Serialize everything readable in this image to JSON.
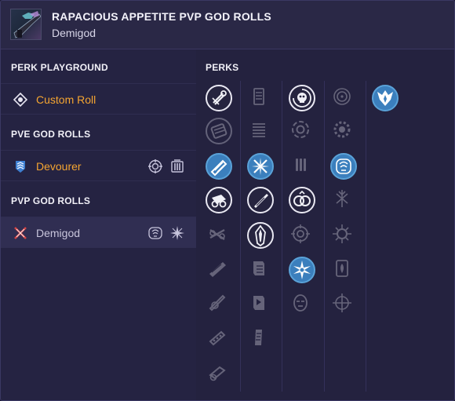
{
  "header": {
    "title": "RAPACIOUS APPETITE PVP GOD ROLLS",
    "subtitle": "Demigod"
  },
  "sidebar": {
    "sections": [
      {
        "heading": "PERK PLAYGROUND",
        "rows": [
          {
            "label": "Custom Roll",
            "icon": "target-dot-icon",
            "color": "#f5a531"
          }
        ]
      },
      {
        "heading": "PVE GOD ROLLS",
        "rows": [
          {
            "label": "Devourer",
            "icon": "chevron-shield-icon",
            "color": "#f5a531",
            "mini_icons": [
              "crosshair-scope-icon",
              "magazine-icon"
            ]
          }
        ]
      },
      {
        "heading": "PVP GOD ROLLS",
        "rows": [
          {
            "label": "Demigod",
            "icon": "crossed-swords-red-icon",
            "color": "#c9c6dc",
            "selected": true,
            "mini_icons": [
              "grip-icon",
              "burst-icon"
            ]
          }
        ]
      }
    ]
  },
  "perks": {
    "heading": "PERKS",
    "columns": [
      {
        "name": "barrels",
        "perks": [
          {
            "icon": "barrel-fluted-icon",
            "state": "selected"
          },
          {
            "icon": "barrel-box-icon",
            "state": "dim"
          },
          {
            "icon": "barrel-chambered-icon",
            "state": "god"
          },
          {
            "icon": "barrel-hammer-icon",
            "state": "selected"
          },
          {
            "icon": "barrel-crossed-icon",
            "state": "dim"
          },
          {
            "icon": "barrel-long-icon",
            "state": "dim"
          },
          {
            "icon": "barrel-arrowhead-icon",
            "state": "dim"
          },
          {
            "icon": "barrel-ported-icon",
            "state": "dim"
          },
          {
            "icon": "barrel-polygonal-icon",
            "state": "dim"
          }
        ]
      },
      {
        "name": "magazines",
        "perks": [
          {
            "icon": "magazine-stack-icon",
            "state": "dim"
          },
          {
            "icon": "magazine-lines-icon",
            "state": "dim"
          },
          {
            "icon": "magazine-ricochet-icon",
            "state": "god"
          },
          {
            "icon": "magazine-bullet-icon",
            "state": "selected"
          },
          {
            "icon": "magazine-flared-icon",
            "state": "selected"
          },
          {
            "icon": "magazine-tactical-icon",
            "state": "dim"
          },
          {
            "icon": "magazine-appended-icon",
            "state": "dim"
          },
          {
            "icon": "magazine-extended-icon",
            "state": "dim"
          }
        ]
      },
      {
        "name": "trait-1",
        "perks": [
          {
            "icon": "skull-reload-icon",
            "state": "selected"
          },
          {
            "icon": "rings-orbit-icon",
            "state": "dim"
          },
          {
            "icon": "ammo-rounds-icon",
            "state": "dim"
          },
          {
            "icon": "double-ring-icon",
            "state": "selected"
          },
          {
            "icon": "target-lock-icon",
            "state": "dim"
          },
          {
            "icon": "star-burst-icon",
            "state": "god"
          },
          {
            "icon": "mask-face-icon",
            "state": "dim"
          }
        ]
      },
      {
        "name": "trait-2",
        "perks": [
          {
            "icon": "crosshair-circle-icon",
            "state": "dim"
          },
          {
            "icon": "gear-ring-icon",
            "state": "dim"
          },
          {
            "icon": "grip-hand-icon",
            "state": "god"
          },
          {
            "icon": "spark-branch-icon",
            "state": "dim"
          },
          {
            "icon": "sunburst-ring-icon",
            "state": "dim"
          },
          {
            "icon": "card-fire-icon",
            "state": "dim"
          },
          {
            "icon": "crosshair-cross-icon",
            "state": "dim"
          }
        ]
      },
      {
        "name": "origin",
        "perks": [
          {
            "icon": "origin-crest-icon",
            "state": "god"
          }
        ]
      }
    ]
  },
  "colors": {
    "accent_orange": "#f5a531",
    "god_roll_blue": "#3b7fbd",
    "panel_bg": "#24223f",
    "selected_row": "#302e52"
  }
}
